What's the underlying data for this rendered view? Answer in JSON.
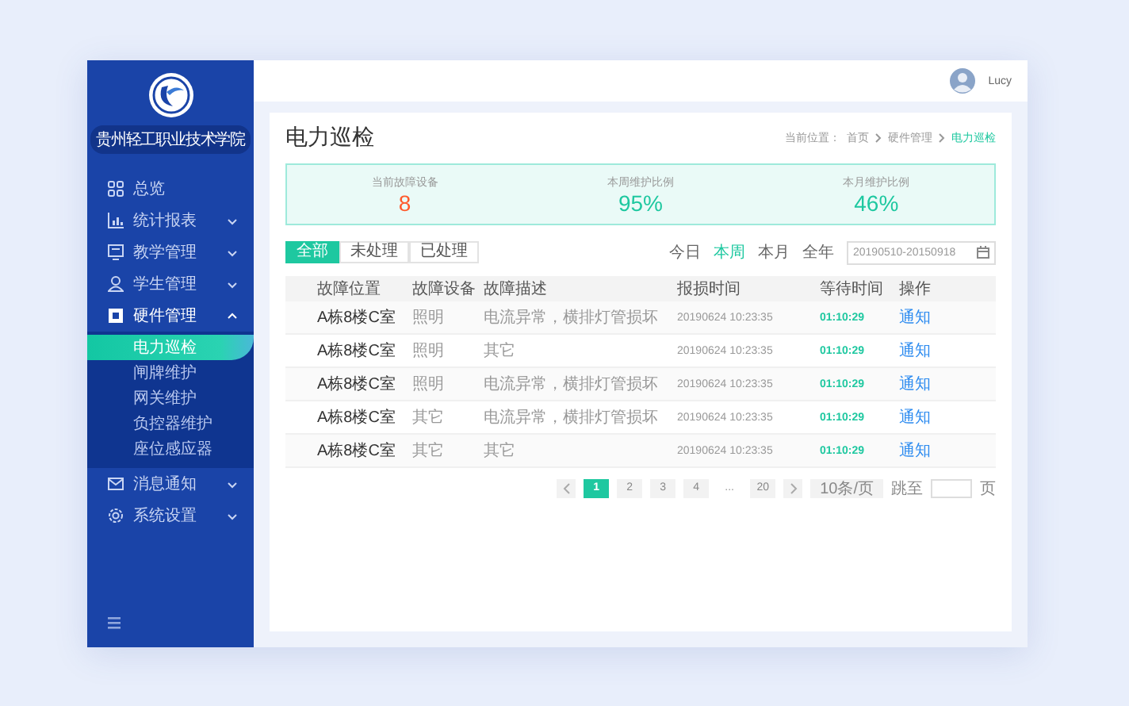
{
  "sidebar": {
    "school_name": "贵州轻工职业技术学院",
    "items": [
      {
        "label": "总览",
        "kind": "link"
      },
      {
        "label": "统计报表",
        "kind": "group",
        "expanded": false
      },
      {
        "label": "教学管理",
        "kind": "group",
        "expanded": false
      },
      {
        "label": "学生管理",
        "kind": "group",
        "expanded": false
      },
      {
        "label": "硬件管理",
        "kind": "group",
        "expanded": true,
        "children": [
          {
            "label": "电力巡检",
            "selected": true
          },
          {
            "label": "闸牌维护",
            "selected": false
          },
          {
            "label": "网关维护",
            "selected": false
          },
          {
            "label": "负控器维护",
            "selected": false
          },
          {
            "label": "座位感应器",
            "selected": false
          }
        ]
      },
      {
        "label": "消息通知",
        "kind": "group",
        "expanded": false
      },
      {
        "label": "系统设置",
        "kind": "group",
        "expanded": false
      }
    ]
  },
  "header": {
    "user_name": "Lucy"
  },
  "page": {
    "title": "电力巡检",
    "breadcrumb": {
      "prefix": "当前位置：",
      "items": [
        {
          "label": "首页",
          "selected": false
        },
        {
          "label": "硬件管理",
          "selected": false
        },
        {
          "label": "电力巡检",
          "selected": true
        }
      ]
    }
  },
  "stats": [
    {
      "label": "当前故障设备",
      "value": "8",
      "color": "#ff5a2c"
    },
    {
      "label": "本周维护比例",
      "value": "95%",
      "color": "#1ec8a0"
    },
    {
      "label": "本月维护比例",
      "value": "46%",
      "color": "#1ec8a0"
    }
  ],
  "filters": [
    {
      "label": "全部",
      "selected": true
    },
    {
      "label": "未处理",
      "selected": false
    },
    {
      "label": "已处理",
      "selected": false
    }
  ],
  "periods": [
    {
      "label": "今日",
      "selected": false
    },
    {
      "label": "本周",
      "selected": true
    },
    {
      "label": "本月",
      "selected": false
    },
    {
      "label": "全年",
      "selected": false
    }
  ],
  "date_range": {
    "value": "20190510-20150918"
  },
  "table": {
    "columns": [
      "故障位置",
      "故障设备",
      "故障描述",
      "报损时间",
      "等待时间",
      "操作"
    ],
    "rows": [
      [
        "A栋8楼C室",
        "照明",
        "电流异常，横排灯管损坏",
        "20190624  10:23:35",
        "01:10:29",
        "通知"
      ],
      [
        "A栋8楼C室",
        "照明",
        "其它",
        "20190624  10:23:35",
        "01:10:29",
        "通知"
      ],
      [
        "A栋8楼C室",
        "照明",
        "电流异常，横排灯管损坏",
        "20190624  10:23:35",
        "01:10:29",
        "通知"
      ],
      [
        "A栋8楼C室",
        "其它",
        "电流异常，横排灯管损坏",
        "20190624  10:23:35",
        "01:10:29",
        "通知"
      ],
      [
        "A栋8楼C室",
        "其它",
        "其它",
        "20190624  10:23:35",
        "01:10:29",
        "通知"
      ]
    ]
  },
  "pagination": {
    "pages": [
      {
        "label": "1",
        "selected": true
      },
      {
        "label": "2",
        "selected": false
      },
      {
        "label": "3",
        "selected": false
      },
      {
        "label": "4",
        "selected": false
      },
      {
        "label": "...",
        "kind": "ellipsis"
      },
      {
        "label": "20",
        "selected": false
      }
    ],
    "page_size": "10条/页",
    "jump_label": "跳至",
    "page_unit": "页"
  }
}
